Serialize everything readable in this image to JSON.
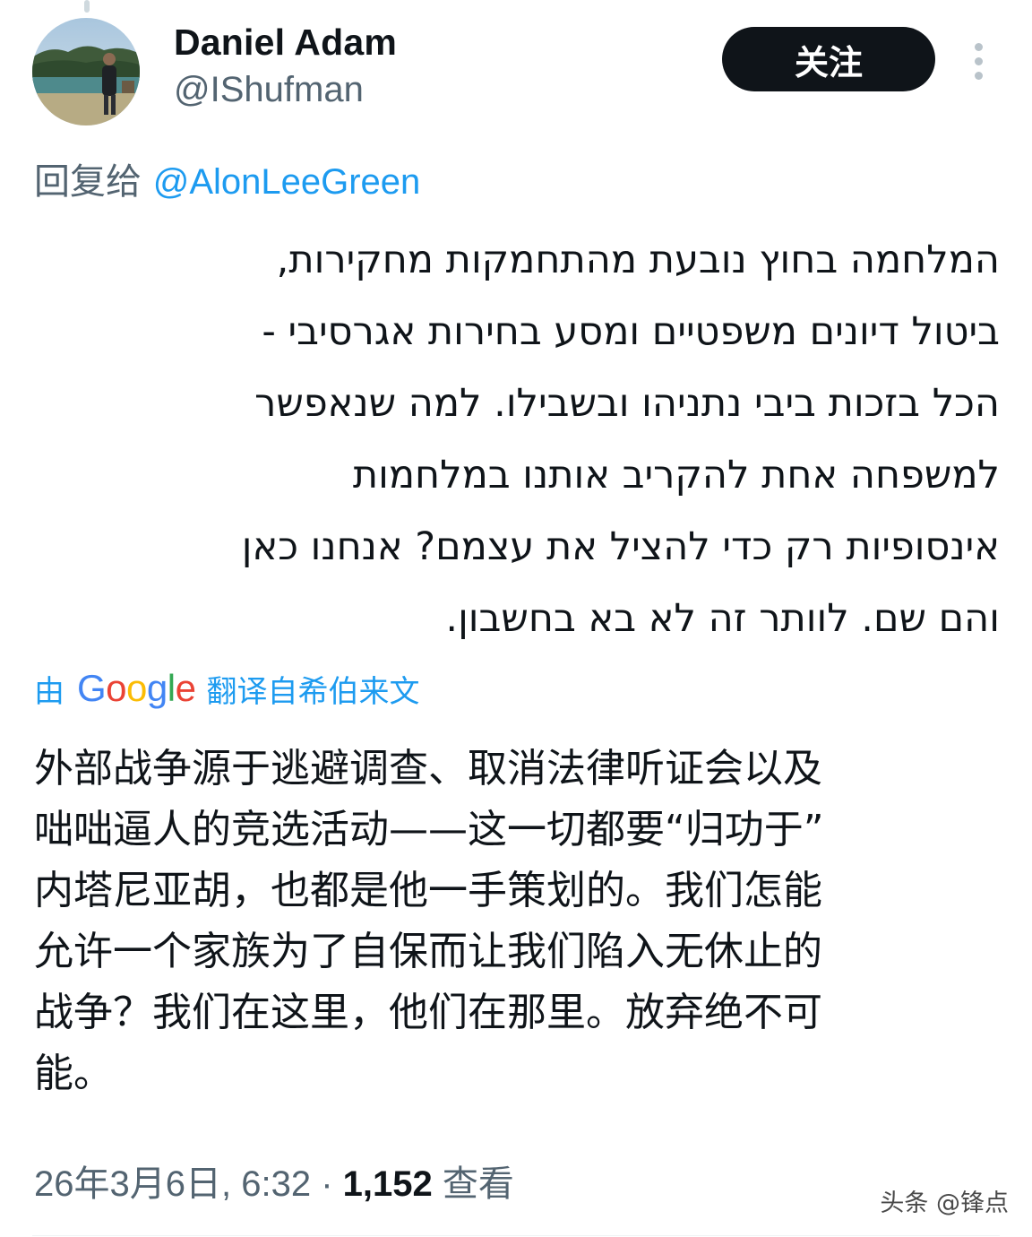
{
  "author": {
    "display_name": "Daniel Adam",
    "handle": "@IShufman",
    "avatar_icon": "user-photo-avatar"
  },
  "actions": {
    "follow_label": "关注",
    "more_icon": "vertical-ellipsis-icon"
  },
  "reply": {
    "prefix": "回复给",
    "mention": "@AlonLeeGreen"
  },
  "tweet": {
    "original_lines": [
      "המלחמה בחוץ נובעת מהתחמקות מחקירות,",
      "ביטול דיונים משפטיים ומסע בחירות אגרסיבי -",
      "הכל בזכות ביבי נתניהו ובשבילו. למה שנאפשר",
      "למשפחה אחת להקריב אותנו במלחמות",
      "אינסופיות רק כדי להציל את עצמם? אנחנו כאן",
      "והם שם. לוותר זה לא בא בחשבון."
    ],
    "translation_prefix": "由",
    "translation_brand": "Google",
    "translation_suffix": "翻译自希伯来文",
    "translated_lines": [
      "外部战争源于逃避调查、取消法律听证会以及",
      "咄咄逼人的竞选活动——这一切都要“归功于”",
      "内塔尼亚胡，也都是他一手策划的。我们怎能",
      "允许一个家族为了自保而让我们陷入无休止的",
      "战争？我们在这里，他们在那里。放弃绝不可",
      "能。"
    ]
  },
  "meta": {
    "timestamp": "26年3月6日, 6:32",
    "separator": "·",
    "views_count": "1,152",
    "views_label": "查看"
  },
  "watermark": "头条 @锋点",
  "colors": {
    "accent": "#1d9bf0",
    "text_primary": "#0f1419",
    "text_secondary": "#536471",
    "button_bg": "#0f1419",
    "google_blue": "#4285F4",
    "google_red": "#EA4335",
    "google_yellow": "#FBBC05",
    "google_green": "#34A853"
  }
}
